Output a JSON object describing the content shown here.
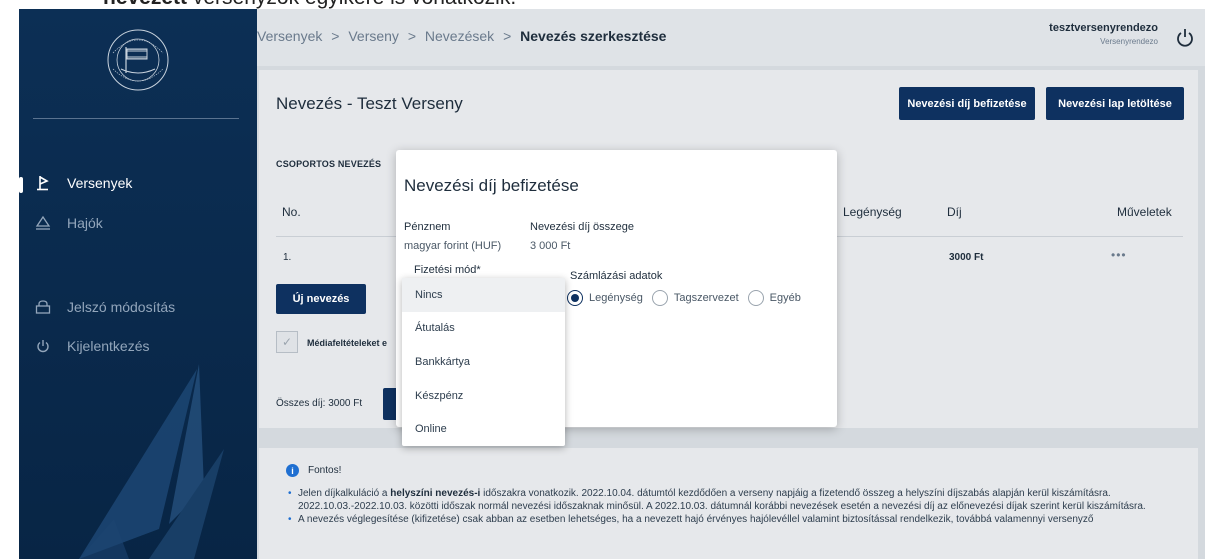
{
  "doc_caption": {
    "prefix": "nevezett",
    "rest": " versenyzők egyikére is vonatkozik."
  },
  "sidebar": {
    "logo_icon": "federation-seal-logo",
    "items": [
      {
        "label": "Versenyek",
        "icon": "sailboat-flag-icon",
        "active": true
      },
      {
        "label": "Hajók",
        "icon": "boat-icon",
        "active": false
      },
      {
        "label": "Jelszó módosítás",
        "icon": "lock-icon",
        "active": false
      },
      {
        "label": "Kijelentkezés",
        "icon": "power-icon",
        "active": false
      }
    ]
  },
  "header": {
    "breadcrumb": [
      "Versenyek",
      "Verseny",
      "Nevezések"
    ],
    "breadcrumb_current": "Nevezés szerkesztése",
    "separator": ">",
    "user_name": "tesztversenyrendezo",
    "user_role": "Versenyrendezo"
  },
  "page": {
    "title": "Nevezés - Teszt Verseny",
    "btn_pay": "Nevezési díj befizetése",
    "btn_download": "Nevezési lap letöltése",
    "section_title": "CSOPORTOS NEVEZÉS",
    "table": {
      "headers": {
        "no": "No.",
        "crew": "Legénység",
        "fee": "Díj",
        "actions": "Műveletek"
      },
      "rows": [
        {
          "no": "1.",
          "fee": "3000 Ft",
          "actions": "•••"
        }
      ]
    },
    "btn_new": "Új nevezés",
    "media_label": "Médiafeltételeket e",
    "checkbox_mark": "✓",
    "total": "Összes díj: 3000 Ft"
  },
  "info": {
    "title": "Fontos!",
    "icon": "info-icon",
    "bullet1_pre": "Jelen díjkalkuláció a ",
    "bullet1_bold": "helyszíni nevezés-i",
    "bullet1_post": " időszakra vonatkozik. 2022.10.04. dátumtól kezdődően a verseny napjáig a fizetendő összeg a helyszíni díjszabás alapján kerül kiszámításra. 2022.10.03.-2022.10.03. közötti időszak normál nevezési időszaknak minősül. A 2022.10.03. dátumnál korábbi nevezések esetén a nevezési díj az előnevezési díjak szerint kerül kiszámításra.",
    "bullet2": "A nevezés véglegesítése (kifizetése) csak abban az esetben lehetséges, ha a nevezett hajó érvényes hajólevéllel valamint biztosítással rendelkezik, továbbá valamennyi versenyző"
  },
  "modal": {
    "title": "Nevezési díj befizetése",
    "currency_label": "Pénznem",
    "currency_value": "magyar forint (HUF)",
    "amount_label": "Nevezési díj összege",
    "amount_value": "3 000 Ft",
    "payment_label": "Fizetési mód*",
    "billing_label": "Számlázási adatok",
    "billing_options": [
      "Legénység",
      "Tagszervezet",
      "Egyéb"
    ],
    "billing_selected": "Legénység"
  },
  "dropdown": {
    "options": [
      "Nincs",
      "Átutalás",
      "Bankkártya",
      "Készpénz",
      "Online"
    ],
    "highlighted": "Nincs"
  },
  "colors": {
    "sidebar": "#0c2f55",
    "primary": "#0e3160",
    "content_bg": "#d4d9de",
    "card_bg": "#e6e8eb",
    "info_blue": "#1f6fd1"
  }
}
